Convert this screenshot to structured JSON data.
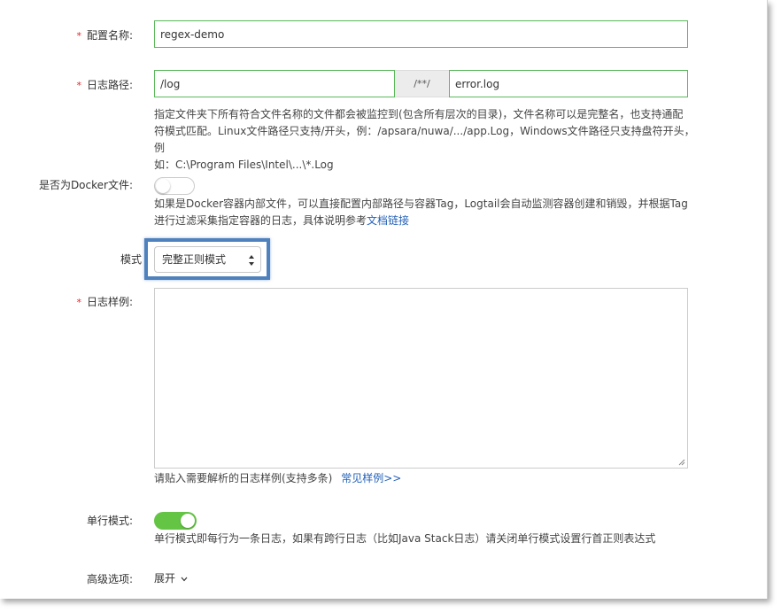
{
  "form": {
    "config_name": {
      "required_mark": "*",
      "label": "配置名称:",
      "value": "regex-demo"
    },
    "log_path": {
      "required_mark": "*",
      "label": "日志路径:",
      "dir_value": "/log",
      "separator": "/**/",
      "file_value": "error.log",
      "help_line1": "指定文件夹下所有符合文件名称的文件都会被监控到(包含所有层次的目录)，文件名称可以是完整名，也支持通配",
      "help_line2": "符模式匹配。Linux文件路径只支持/开头，例：/apsara/nuwa/.../app.Log，Windows文件路径只支持盘符开头，例",
      "help_line3": "如：C:\\Program Files\\Intel\\...\\*.Log"
    },
    "docker": {
      "label": "是否为Docker文件:",
      "enabled": false,
      "help_line1": "如果是Docker容器内部文件，可以直接配置内部路径与容器Tag，Logtail会自动监测容器创建和销毁，并根据Tag",
      "help_line2_prefix": "进行过滤采集指定容器的日志，具体说明参考",
      "help_link": "文档链接"
    },
    "mode": {
      "label": "模式",
      "selected": "完整正则模式"
    },
    "log_sample": {
      "required_mark": "*",
      "label": "日志样例:",
      "value": "",
      "help_text": "请贴入需要解析的日志样例(支持多条)",
      "help_link": "常见样例>>"
    },
    "single_line": {
      "label": "单行模式:",
      "enabled": true,
      "help_text": "单行模式即每行为一条日志，如果有跨行日志（比如Java Stack日志）请关闭单行模式设置行首正则表达式"
    },
    "advanced": {
      "label": "高级选项:",
      "toggle_text": "展开"
    }
  },
  "colors": {
    "required": "#e0242b",
    "valid_border": "#5cb85c",
    "link": "#2461b8",
    "toggle_on": "#64c545",
    "highlight_border": "#4f81bd"
  },
  "icons": {
    "select_arrows": "up-down-caret-icon",
    "expand": "chevron-down-icon",
    "resize": "resize-grip-icon"
  }
}
